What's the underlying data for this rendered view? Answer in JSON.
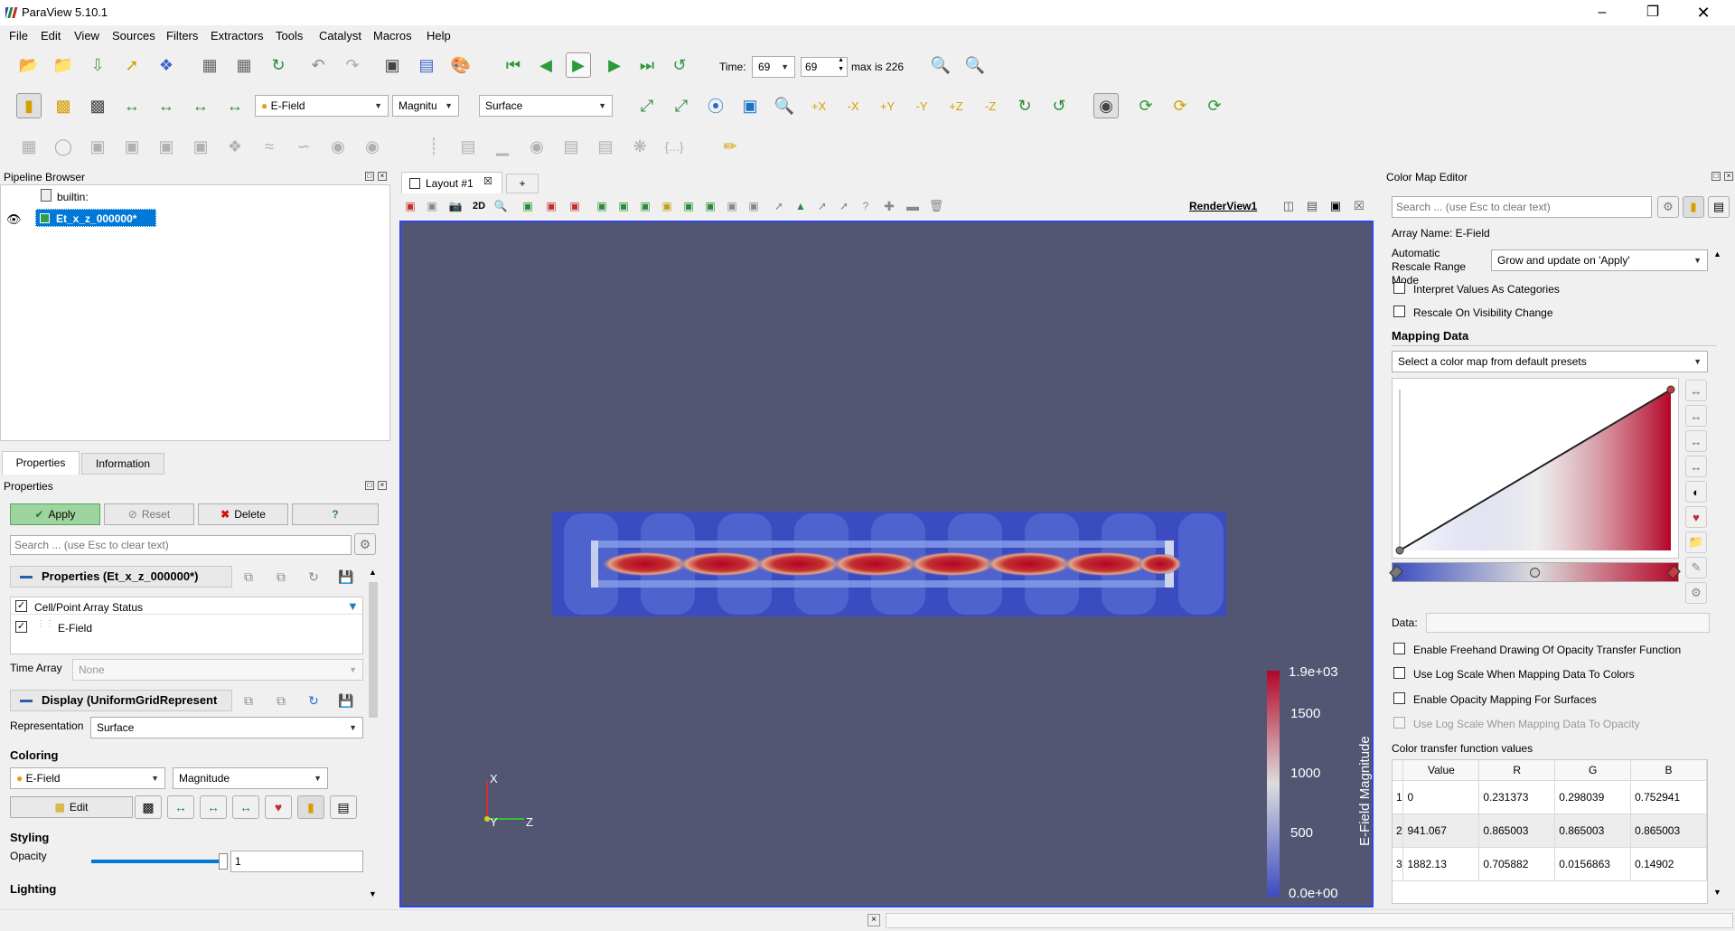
{
  "app": {
    "title": "ParaView 5.10.1"
  },
  "menu": [
    "File",
    "Edit",
    "View",
    "Sources",
    "Filters",
    "Extractors",
    "Tools",
    "Catalyst",
    "Macros",
    "Help"
  ],
  "time_toolbar": {
    "label": "Time:",
    "value": "69",
    "step": "69",
    "max_text": "max is 226"
  },
  "active_vars": {
    "array": "E-Field",
    "component": "Magnitu",
    "representation": "Surface"
  },
  "pipeline": {
    "title": "Pipeline Browser",
    "root": "builtin:",
    "item": "Et_x_z_000000*"
  },
  "left_tabs": [
    "Properties",
    "Information"
  ],
  "properties": {
    "panel_title": "Properties",
    "apply": "Apply",
    "reset": "Reset",
    "delete": "Delete",
    "help": "?",
    "search_placeholder": "Search ... (use Esc to clear text)",
    "section1": "Properties (Et_x_z_000000*)",
    "array_status_header": "Cell/Point Array Status",
    "array_item": "E-Field",
    "time_array_label": "Time Array",
    "time_array_value": "None",
    "section2": "Display (UniformGridRepresent",
    "representation_label": "Representation",
    "representation_value": "Surface",
    "coloring_label": "Coloring",
    "coloring_array": "E-Field",
    "coloring_mode": "Magnitude",
    "edit_label": "Edit",
    "styling_label": "Styling",
    "opacity_label": "Opacity",
    "opacity_value": "1",
    "opacity_fraction": 1.0,
    "lighting_label": "Lighting"
  },
  "layout": {
    "tab": "Layout #1",
    "plus": "+",
    "view_name": "RenderView1",
    "mode_2d": "2D"
  },
  "scalar_bar": {
    "title": "E-Field Magnitude",
    "ticks": [
      "1.9e+03",
      "1500",
      "1000",
      "500",
      "0.0e+00"
    ]
  },
  "axes": {
    "x": "X",
    "y": "Y",
    "z": "Z"
  },
  "colormap_editor": {
    "title": "Color Map Editor",
    "search_placeholder": "Search ... (use Esc to clear text)",
    "array_name": "Array Name: E-Field",
    "rescale_label": "Automatic Rescale Range Mode",
    "rescale_value": "Grow and update on 'Apply'",
    "interpret_categories": "Interpret Values As Categories",
    "rescale_visibility": "Rescale On Visibility Change",
    "mapping_data": "Mapping Data",
    "preset_placeholder": "Select a color map from default presets",
    "data_label": "Data:",
    "opt_freehand": "Enable Freehand Drawing Of Opacity Transfer Function",
    "opt_logscale": "Use Log Scale When Mapping Data To Colors",
    "opt_opacity_surfaces": "Enable Opacity Mapping For Surfaces",
    "opt_log_opacity": "Use Log Scale When Mapping Data To Opacity",
    "ctf_label": "Color transfer function values",
    "table_headers": [
      "Value",
      "R",
      "G",
      "B"
    ],
    "table_rows": [
      {
        "idx": "1",
        "value": "0",
        "r": "0.231373",
        "g": "0.298039",
        "b": "0.752941"
      },
      {
        "idx": "2",
        "value": "941.067",
        "r": "0.865003",
        "g": "0.865003",
        "b": "0.865003"
      },
      {
        "idx": "3",
        "value": "1882.13",
        "r": "0.705882",
        "g": "0.0156863",
        "b": "0.14902"
      }
    ]
  },
  "colors": {
    "render_bg": "#525673",
    "cool": "#3b4cc0",
    "warm": "#b40426",
    "selection": "#0078d7"
  }
}
